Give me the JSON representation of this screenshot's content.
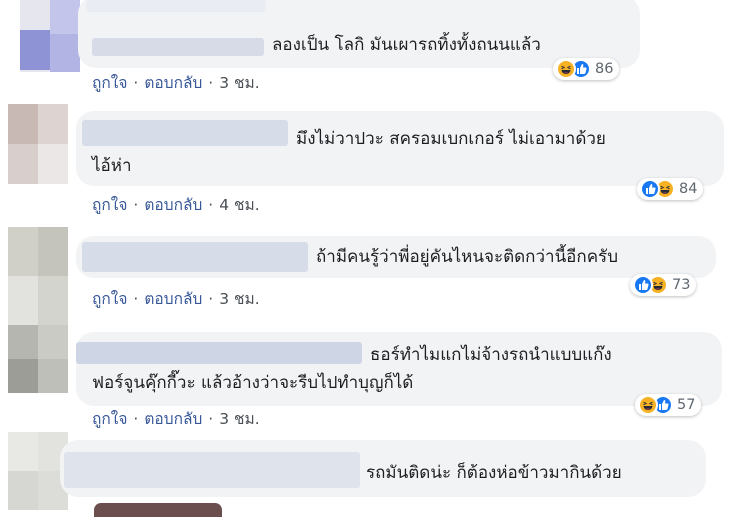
{
  "comments": [
    {
      "text_lines": [
        "ลองเป็น โลกิ มันเผารถทิ้งทั้งถนนแล้ว"
      ],
      "actions": {
        "like": "ถูกใจ",
        "separator": "·",
        "reply": "ตอบกลับ",
        "time": "3 ชม."
      },
      "reactions": {
        "icons": [
          "haha-icon",
          "like-icon"
        ],
        "count": "86"
      }
    },
    {
      "text_lines": [
        "มึงไม่วาปวะ สครอมเบกเกอร์ ไม่เอามาด้วย",
        "ไอ้ห่า"
      ],
      "actions": {
        "like": "ถูกใจ",
        "separator": "·",
        "reply": "ตอบกลับ",
        "time": "4 ชม."
      },
      "reactions": {
        "icons": [
          "like-icon",
          "haha-icon"
        ],
        "count": "84"
      }
    },
    {
      "text_lines": [
        "ถ้ามีคนรู้ว่าพี่อยู่คันไหนจะติดกว่านี้อีกครับ"
      ],
      "actions": {
        "like": "ถูกใจ",
        "separator": "·",
        "reply": "ตอบกลับ",
        "time": "3 ชม."
      },
      "reactions": {
        "icons": [
          "like-icon",
          "haha-icon"
        ],
        "count": "73"
      }
    },
    {
      "text_lines": [
        "ธอร์ทำไมแกไม่จ้างรถนำแบบแก๊ง",
        "ฟอร์จูนคุ๊กกี๊วะ แล้วอ้างว่าจะรีบไปทำบุญก็ได้"
      ],
      "actions": {
        "like": "ถูกใจ",
        "separator": "·",
        "reply": "ตอบกลับ",
        "time": "3 ชม."
      },
      "reactions": {
        "icons": [
          "haha-icon",
          "like-icon"
        ],
        "count": "57"
      }
    },
    {
      "text_lines": [
        "รถมันติดน่ะ ก็ต้องห่อข้าวมากินด้วย"
      ]
    }
  ],
  "colors": {
    "bubble": "#f2f3f5",
    "link": "#385898",
    "like_blue": "#1877f2",
    "haha_yellow": "#f7b125"
  }
}
